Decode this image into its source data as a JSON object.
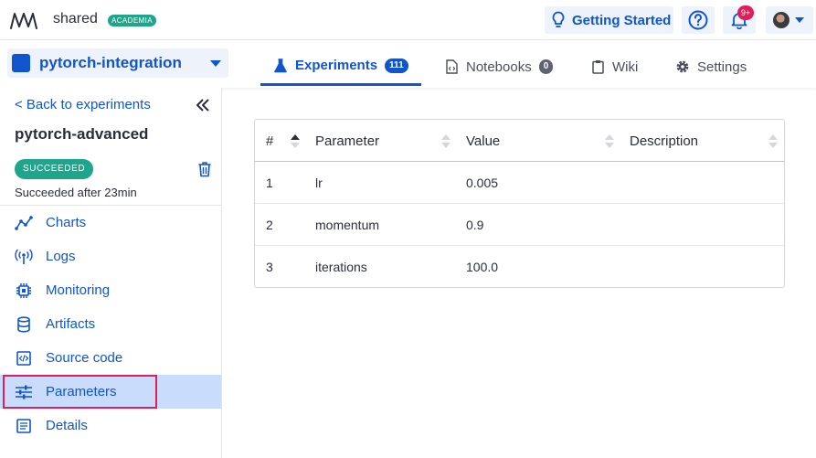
{
  "topbar": {
    "workspace": "shared",
    "workspace_badge": "ACADEMIA",
    "getting_started": "Getting Started",
    "notifications_badge": "9+"
  },
  "project": {
    "name": "pytorch-integration"
  },
  "tabs": [
    {
      "label": "Experiments",
      "count": "111",
      "active": true
    },
    {
      "label": "Notebooks",
      "count": "0",
      "active": false
    },
    {
      "label": "Wiki",
      "active": false
    },
    {
      "label": "Settings",
      "active": false
    }
  ],
  "sidebar": {
    "back": "< Back to experiments",
    "experiment_name": "pytorch-advanced",
    "status": "SUCCEEDED",
    "status_text": "Succeeded after 23min",
    "items": [
      {
        "label": "Charts",
        "icon": "chart-line-icon"
      },
      {
        "label": "Logs",
        "icon": "broadcast-icon"
      },
      {
        "label": "Monitoring",
        "icon": "chip-icon"
      },
      {
        "label": "Artifacts",
        "icon": "database-icon"
      },
      {
        "label": "Source code",
        "icon": "code-file-icon"
      },
      {
        "label": "Parameters",
        "icon": "sliders-icon",
        "active": true
      },
      {
        "label": "Details",
        "icon": "list-document-icon"
      }
    ]
  },
  "table": {
    "columns": [
      "#",
      "Parameter",
      "Value",
      "Description"
    ],
    "rows": [
      {
        "index": "1",
        "parameter": "lr",
        "value": "0.005",
        "description": ""
      },
      {
        "index": "2",
        "parameter": "momentum",
        "value": "0.9",
        "description": ""
      },
      {
        "index": "3",
        "parameter": "iterations",
        "value": "100.0",
        "description": ""
      }
    ]
  },
  "colors": {
    "accent": "#1155cc",
    "success": "#1ea58c",
    "alert": "#e01e5a",
    "active_bg": "#c9dcfb"
  }
}
